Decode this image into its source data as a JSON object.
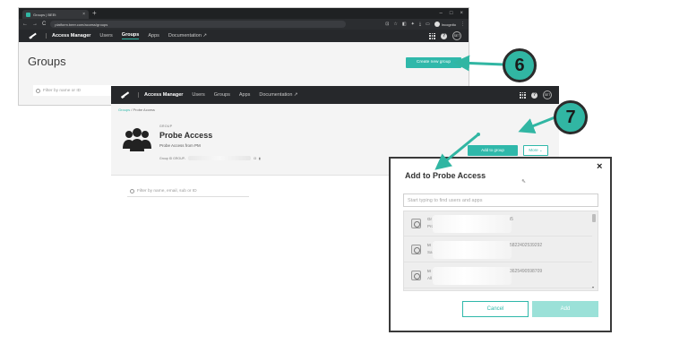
{
  "browser": {
    "tab_title": "Groups | BEEt",
    "tab_close": "×",
    "new_tab": "+",
    "window_controls": [
      "–",
      "□",
      "×"
    ],
    "url": "platform.beer.com/access/groups",
    "nav_icons": [
      "←",
      "→",
      "C"
    ],
    "url_icons": [
      "⊡",
      "☆",
      "◧",
      "✦",
      "⤓",
      "▭"
    ],
    "profile_label": "Incognito",
    "menu_icon": "⋮"
  },
  "appnav": {
    "brand": "Access Manager",
    "links": [
      "Users",
      "Groups",
      "Apps",
      "Documentation"
    ],
    "active_index": 1,
    "help_glyph": "?",
    "user_initials": "SET"
  },
  "groups_page": {
    "title": "Groups",
    "create_button": "Create new group",
    "filter_placeholder": "Filter by name or ID"
  },
  "group_detail": {
    "breadcrumb_link": "Groups",
    "breadcrumb_sep": " / ",
    "breadcrumb_current": "Probe Access",
    "label": "GROUP",
    "name": "Probe Access",
    "description": "Probe Access from PM",
    "id_label": "Group ID GROUP-",
    "id_tail": "i3",
    "add_button": "Add to group",
    "more_button": "More ⌄",
    "filter_placeholder": "Filter by name, email, sub or ID"
  },
  "modal": {
    "title": "Add to Probe Access",
    "close_glyph": "×",
    "cursor_glyph": "⇖",
    "search_placeholder": "Start typing to find users and apps",
    "items": [
      {
        "line1": "Gr",
        "line2": "Pro",
        "id": "i5"
      },
      {
        "line1": "M",
        "line2": "Sa",
        "id": "5822402539292"
      },
      {
        "line1": "M",
        "line2": "All",
        "id": "3625490598709"
      }
    ],
    "scroll_down_glyph": "▾",
    "cancel_button": "Cancel",
    "add_button": "Add"
  },
  "callouts": {
    "step_6": "6",
    "step_7": "7"
  },
  "colors": {
    "accent": "#2fb8aa",
    "nav_bg": "#26282b",
    "callout": "#31b6a3"
  }
}
